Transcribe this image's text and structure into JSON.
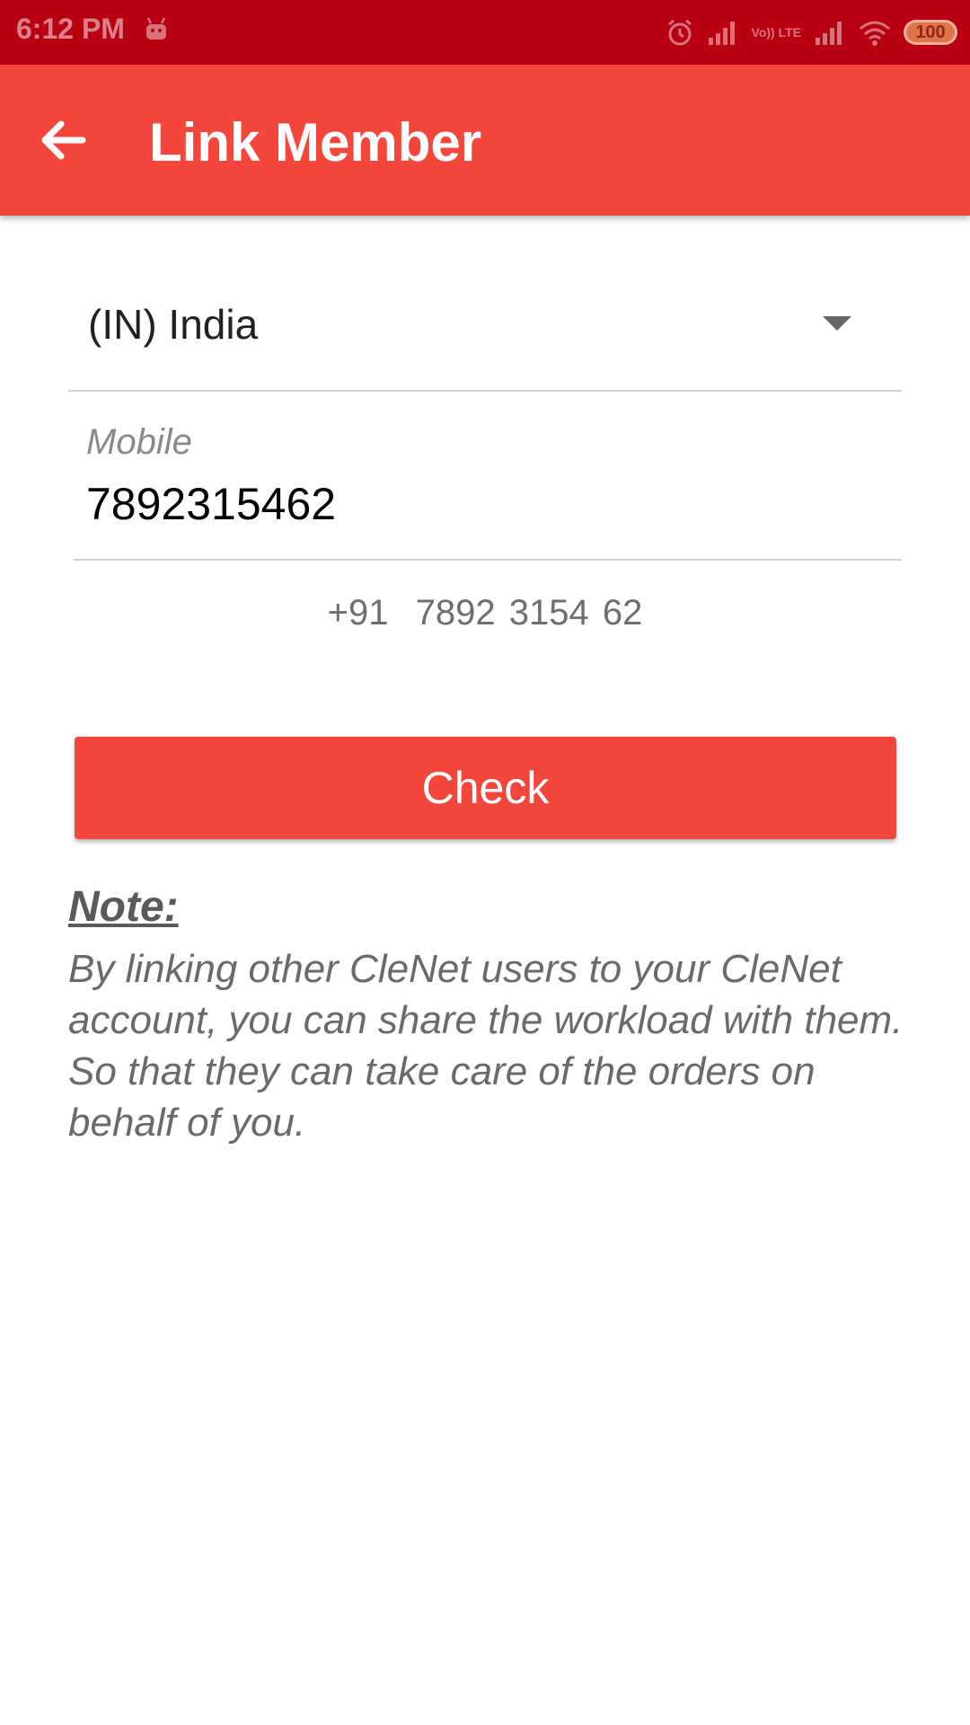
{
  "status_bar": {
    "time": "6:12 PM",
    "icons": [
      "android-debug-icon",
      "alarm-icon",
      "signal-icon",
      "volte-icon",
      "signal-icon",
      "wifi-icon",
      "battery-icon"
    ],
    "volte_text": "Vo)) LTE",
    "battery_level": "100"
  },
  "app_bar": {
    "title": "Link Member",
    "back_icon": "arrow-left-icon",
    "color": "#f4463b"
  },
  "form": {
    "country": {
      "selected": "(IN) India",
      "icon": "dropdown-arrow-icon"
    },
    "mobile": {
      "label": "Mobile",
      "value": "7892315462"
    },
    "formatted_number": "+91  7892 3154 62",
    "check_label": "Check"
  },
  "note": {
    "title": "Note:",
    "body": "By linking other CleNet users to your CleNet account, you can share the workload with them. So that they can take care of the orders on behalf of you."
  },
  "colors": {
    "status_bar": "#b80012",
    "accent": "#f4463b"
  }
}
